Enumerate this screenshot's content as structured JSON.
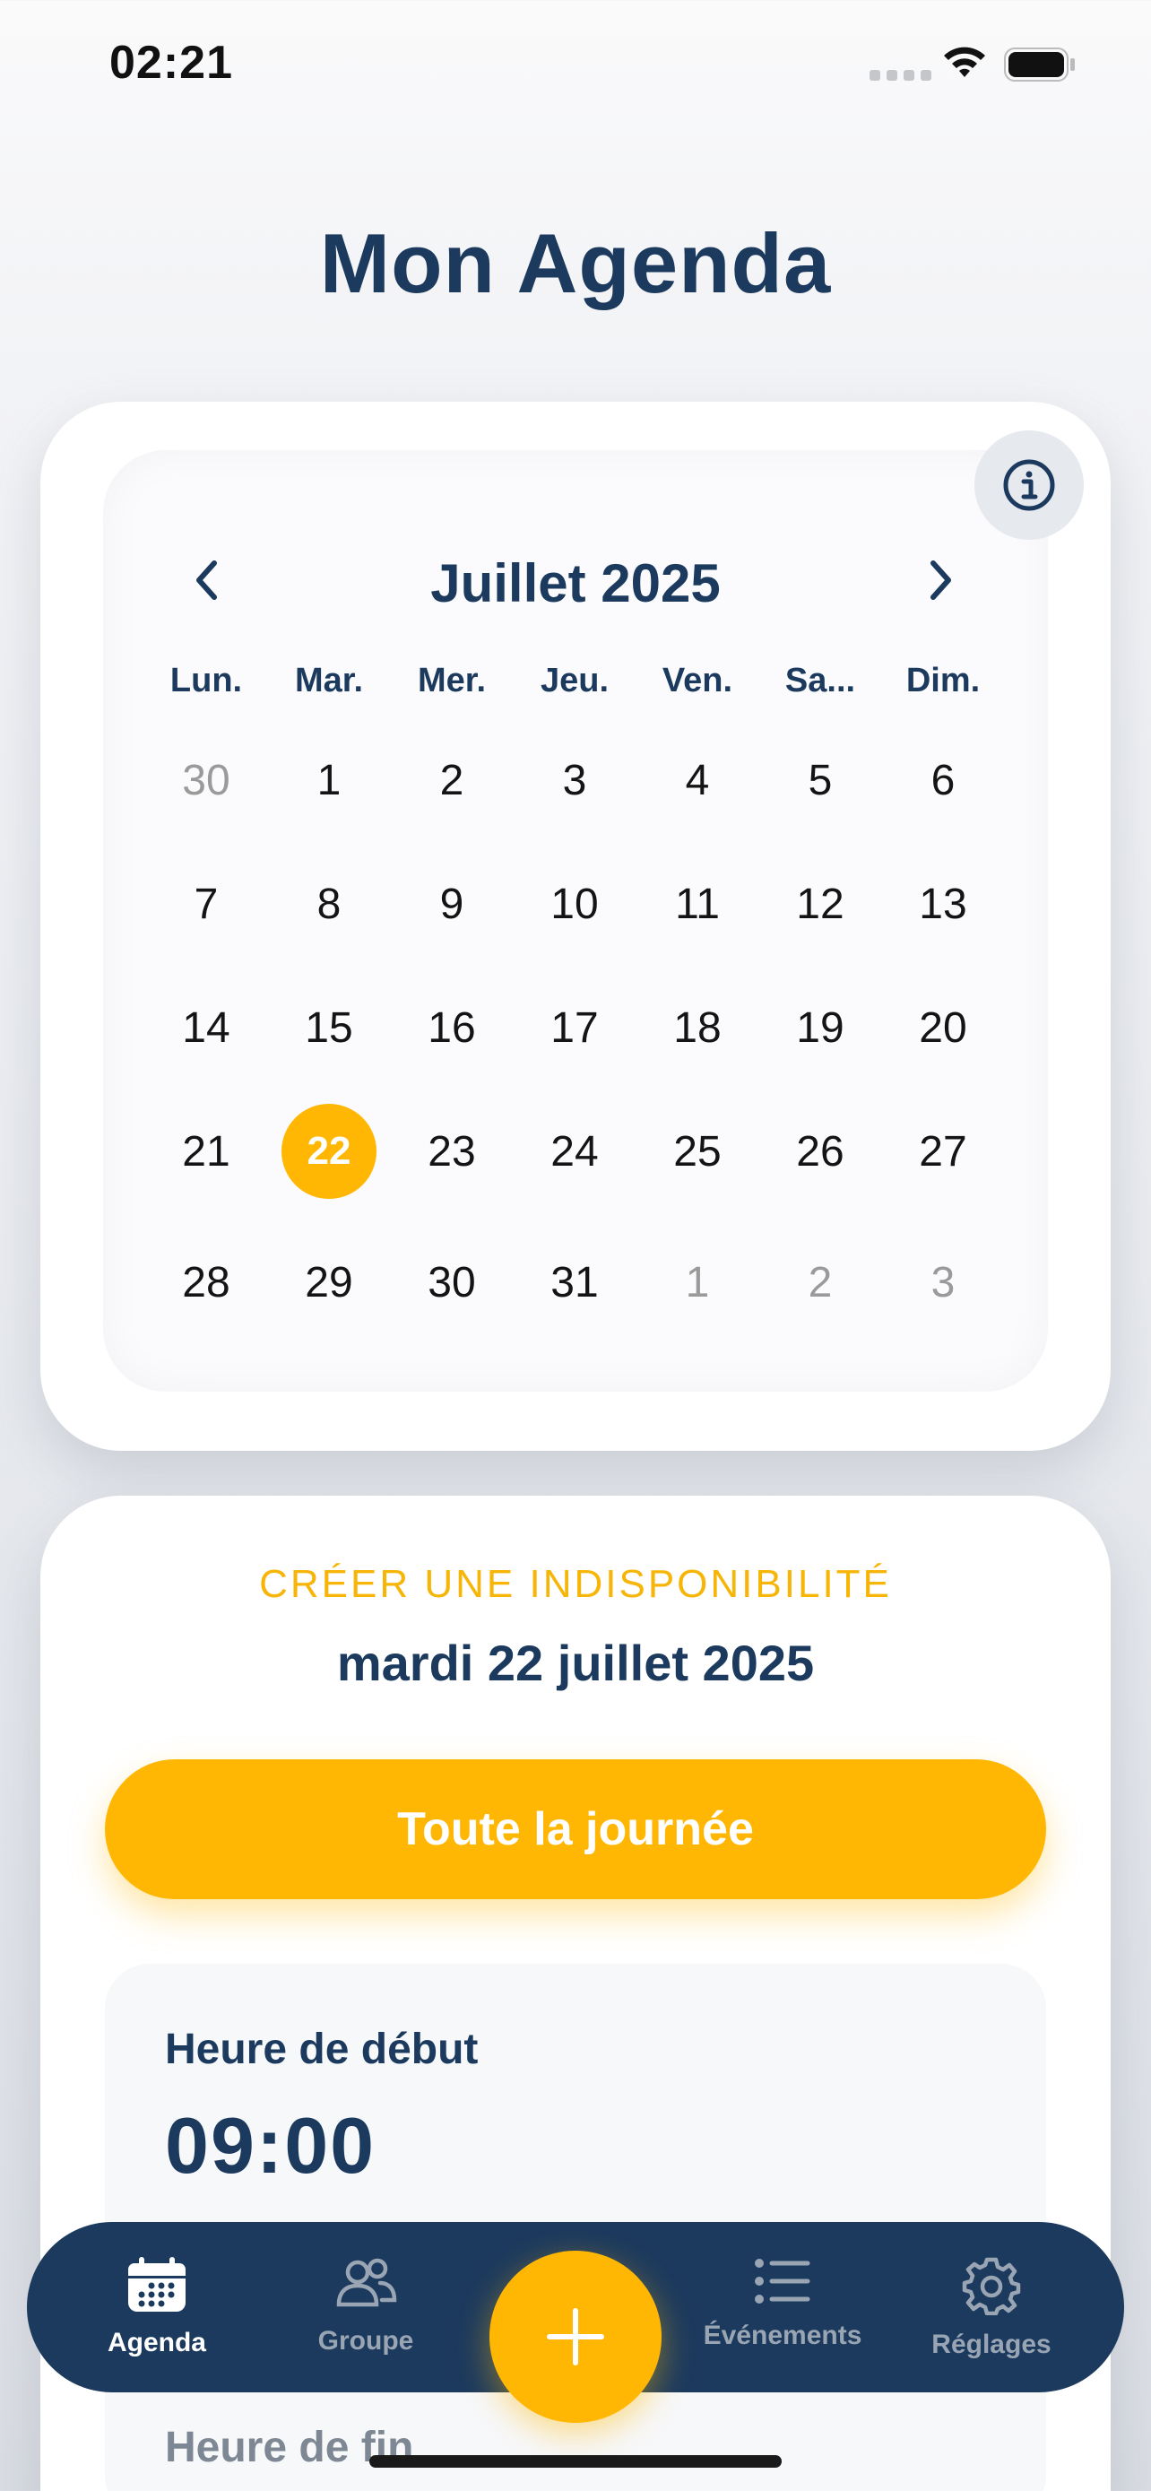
{
  "status_bar": {
    "time": "02:21"
  },
  "header": {
    "title": "Mon Agenda"
  },
  "calendar": {
    "month_label": "Juillet 2025",
    "weekdays": [
      "Lun.",
      "Mar.",
      "Mer.",
      "Jeu.",
      "Ven.",
      "Sa...",
      "Dim."
    ],
    "weeks": [
      [
        {
          "d": "30",
          "muted": true
        },
        {
          "d": "1"
        },
        {
          "d": "2"
        },
        {
          "d": "3"
        },
        {
          "d": "4"
        },
        {
          "d": "5"
        },
        {
          "d": "6"
        }
      ],
      [
        {
          "d": "7"
        },
        {
          "d": "8"
        },
        {
          "d": "9"
        },
        {
          "d": "10"
        },
        {
          "d": "11"
        },
        {
          "d": "12"
        },
        {
          "d": "13"
        }
      ],
      [
        {
          "d": "14"
        },
        {
          "d": "15"
        },
        {
          "d": "16"
        },
        {
          "d": "17"
        },
        {
          "d": "18"
        },
        {
          "d": "19"
        },
        {
          "d": "20"
        }
      ],
      [
        {
          "d": "21"
        },
        {
          "d": "22",
          "selected": true
        },
        {
          "d": "23"
        },
        {
          "d": "24"
        },
        {
          "d": "25"
        },
        {
          "d": "26"
        },
        {
          "d": "27"
        }
      ],
      [
        {
          "d": "28"
        },
        {
          "d": "29"
        },
        {
          "d": "30"
        },
        {
          "d": "31"
        },
        {
          "d": "1",
          "muted": true
        },
        {
          "d": "2",
          "muted": true
        },
        {
          "d": "3",
          "muted": true
        }
      ]
    ]
  },
  "unavailability": {
    "kicker": "CRÉER UNE INDISPONIBILITÉ",
    "date": "mardi 22 juillet 2025",
    "all_day_label": "Toute la journée",
    "start_label": "Heure de début",
    "start_value": "09:00",
    "end_label": "Heure de fin"
  },
  "tab_bar": {
    "items": [
      {
        "label": "Agenda",
        "icon": "calendar-icon",
        "active": true
      },
      {
        "label": "Groupe",
        "icon": "group-icon",
        "active": false
      },
      {
        "label": "Événements",
        "icon": "list-icon",
        "active": false
      },
      {
        "label": "Réglages",
        "icon": "gear-icon",
        "active": false
      }
    ],
    "fab_icon": "plus-icon"
  },
  "colors": {
    "accent": "#ffb703",
    "navy": "#1c3a5e"
  }
}
